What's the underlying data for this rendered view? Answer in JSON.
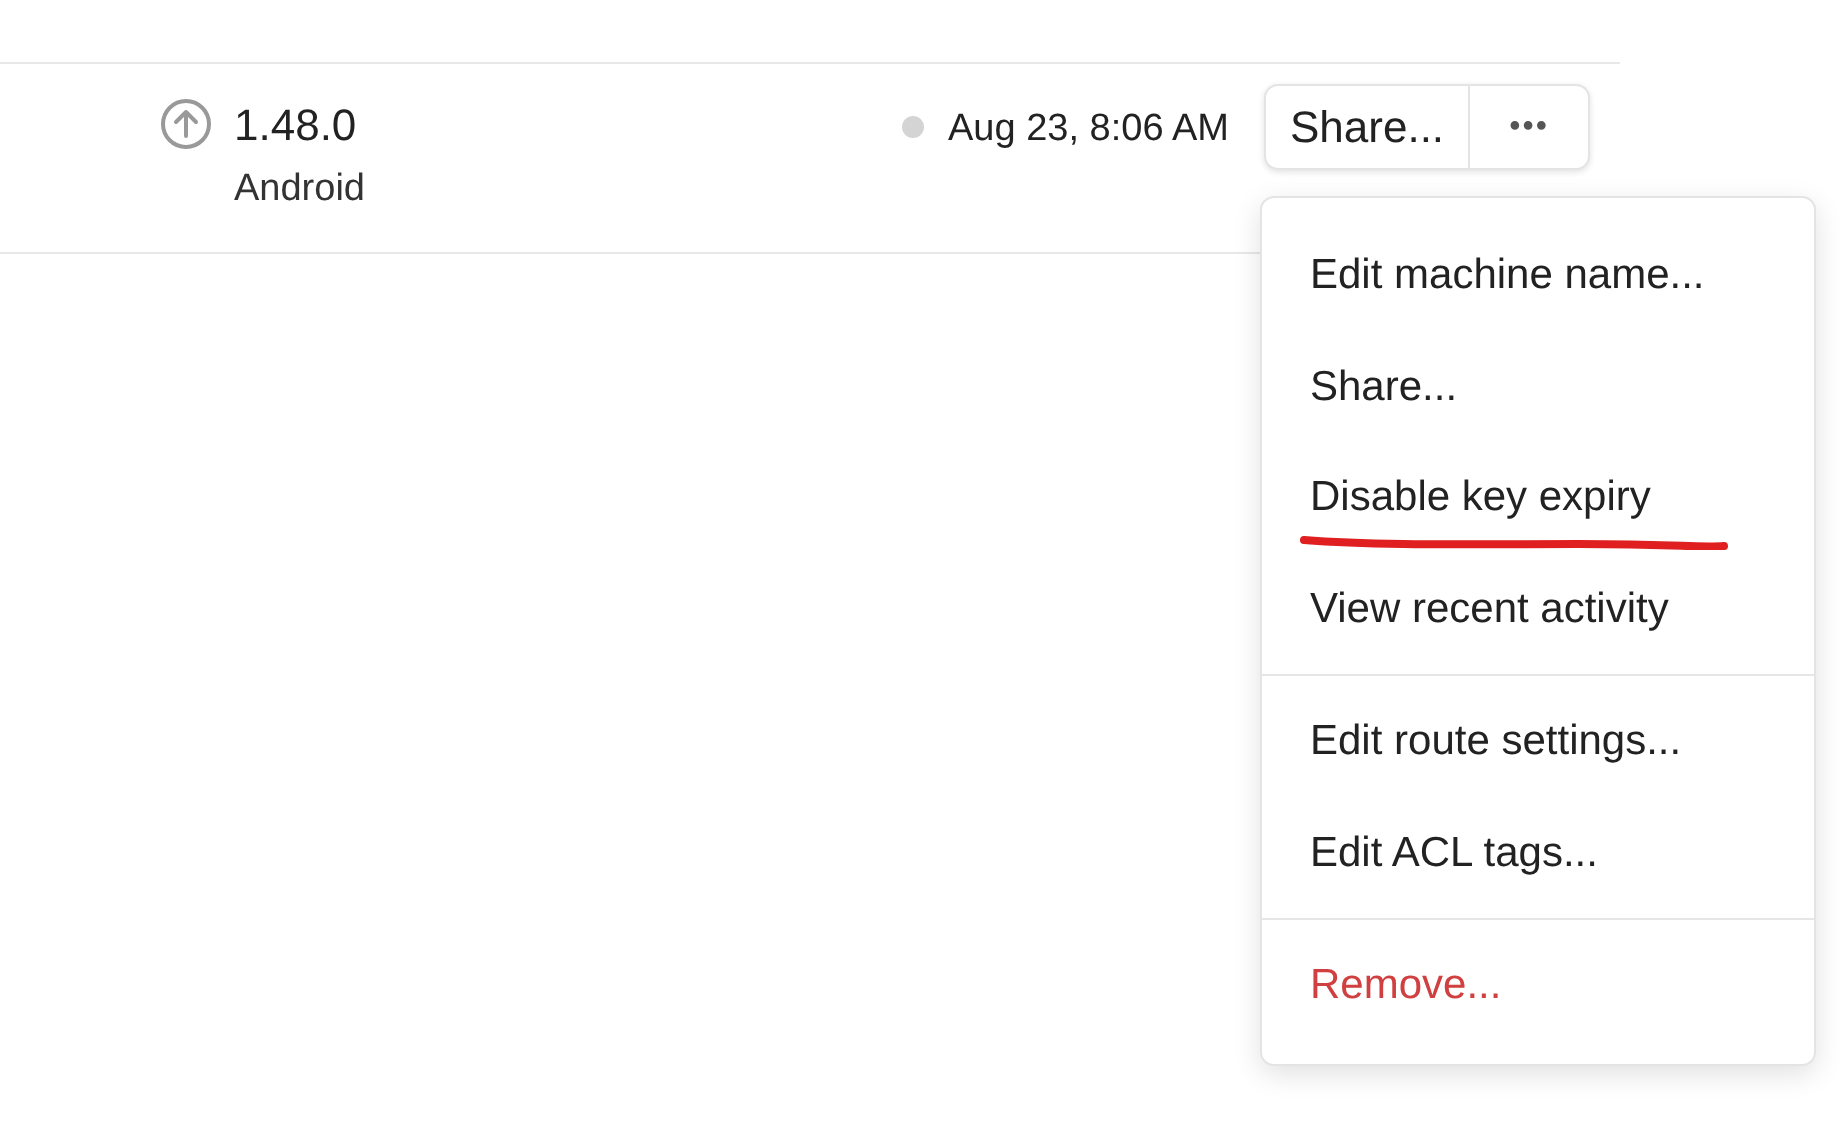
{
  "machine": {
    "version": "1.48.0",
    "os": "Android",
    "last_seen": "Aug 23, 8:06 AM",
    "online": false
  },
  "share_button": "Share...",
  "more_button": "•••",
  "menu": {
    "groups": [
      [
        {
          "label": "Edit machine name...",
          "kind": "normal",
          "underlined": false
        },
        {
          "label": "Share...",
          "kind": "normal",
          "underlined": false
        },
        {
          "label": "Disable key expiry",
          "kind": "normal",
          "underlined": true
        },
        {
          "label": "View recent activity",
          "kind": "normal",
          "underlined": false
        }
      ],
      [
        {
          "label": "Edit route settings...",
          "kind": "normal",
          "underlined": false
        },
        {
          "label": "Edit ACL tags...",
          "kind": "normal",
          "underlined": false
        }
      ],
      [
        {
          "label": "Remove...",
          "kind": "danger",
          "underlined": false
        }
      ]
    ]
  }
}
